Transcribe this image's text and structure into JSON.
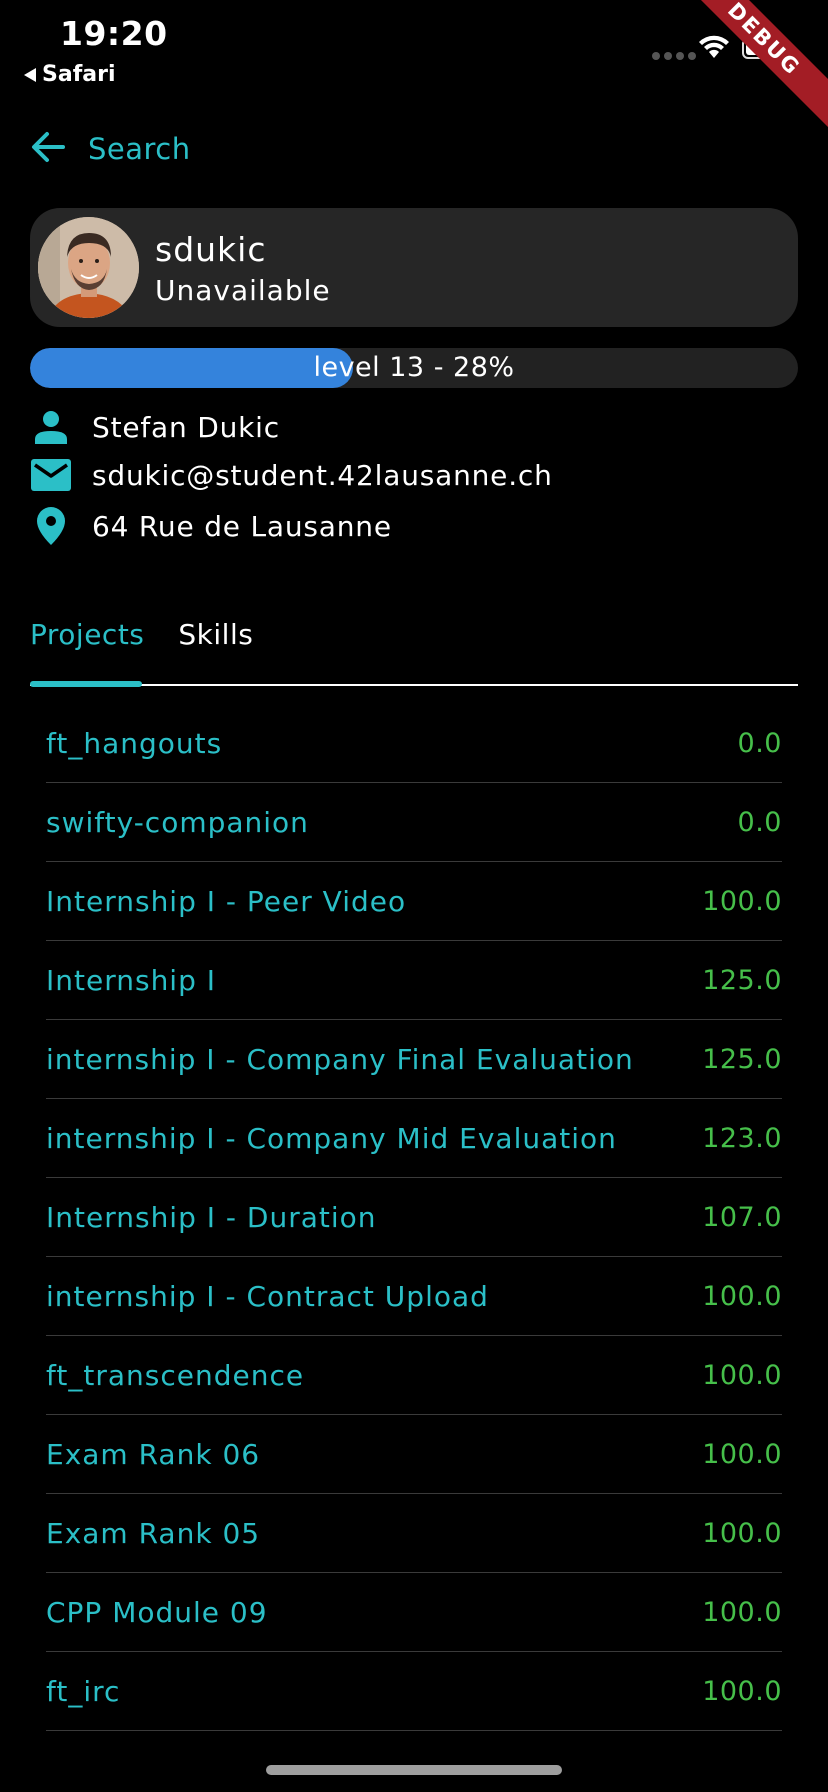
{
  "status_bar": {
    "time": "19:20",
    "back_app": "Safari"
  },
  "debug_banner": "DEBUG",
  "appbar": {
    "title": "Search"
  },
  "profile": {
    "login": "sdukic",
    "status": "Unavailable",
    "level_label": "level 13 - 28%",
    "level_progress": 0.42
  },
  "info": {
    "name": "Stefan Dukic",
    "email": "sdukic@student.42lausanne.ch",
    "address": "64 Rue de Lausanne"
  },
  "tabs": {
    "projects": "Projects",
    "skills": "Skills"
  },
  "projects": [
    {
      "name": "ft_hangouts",
      "mark": "0.0"
    },
    {
      "name": "swifty-companion",
      "mark": "0.0"
    },
    {
      "name": "Internship I - Peer Video",
      "mark": "100.0"
    },
    {
      "name": "Internship I",
      "mark": "125.0"
    },
    {
      "name": "internship I - Company Final Evaluation",
      "mark": "125.0"
    },
    {
      "name": "internship I - Company Mid Evaluation",
      "mark": "123.0"
    },
    {
      "name": "Internship I - Duration",
      "mark": "107.0"
    },
    {
      "name": "internship I - Contract Upload",
      "mark": "100.0"
    },
    {
      "name": "ft_transcendence",
      "mark": "100.0"
    },
    {
      "name": "Exam Rank 06",
      "mark": "100.0"
    },
    {
      "name": "Exam Rank 05",
      "mark": "100.0"
    },
    {
      "name": "CPP Module 09",
      "mark": "100.0"
    },
    {
      "name": "ft_irc",
      "mark": "100.0"
    }
  ],
  "colors": {
    "accent": "#2bbfc7",
    "mark": "#46bf4a",
    "progress": "#3483dc",
    "card": "#262626"
  }
}
